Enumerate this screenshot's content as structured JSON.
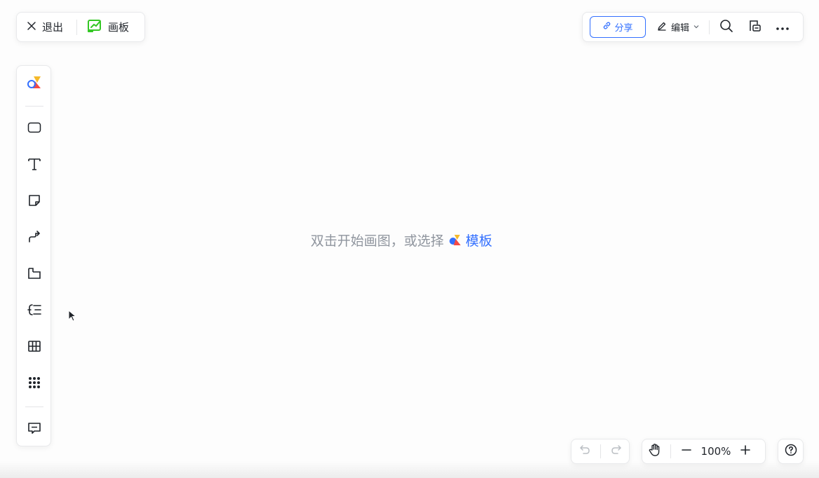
{
  "header": {
    "exit_label": "退出",
    "board_label": "画板",
    "share_label": "分享",
    "edit_label": "编辑"
  },
  "canvas": {
    "hint_text": "双击开始画图，或选择",
    "template_link": "模板"
  },
  "zoom": {
    "level": "100%"
  },
  "colors": {
    "accent": "#3370ff",
    "board_icon": "#34c724",
    "hint_text": "#8f959e"
  },
  "icons": {
    "top_left": [
      "close-icon",
      "board-icon"
    ],
    "top_right": [
      "link-icon",
      "pencil-icon",
      "chevron-down-icon",
      "search-icon",
      "comment-doc-icon",
      "more-icon"
    ],
    "toolbar": [
      "shapes-library-icon",
      "rectangle-icon",
      "text-icon",
      "sticky-note-icon",
      "connector-icon",
      "frame-icon",
      "mindmap-icon",
      "table-icon",
      "more-tools-icon",
      "comment-icon"
    ],
    "bottom": [
      "undo-icon",
      "redo-icon",
      "hand-icon",
      "zoom-out-icon",
      "zoom-in-icon",
      "help-icon"
    ]
  }
}
